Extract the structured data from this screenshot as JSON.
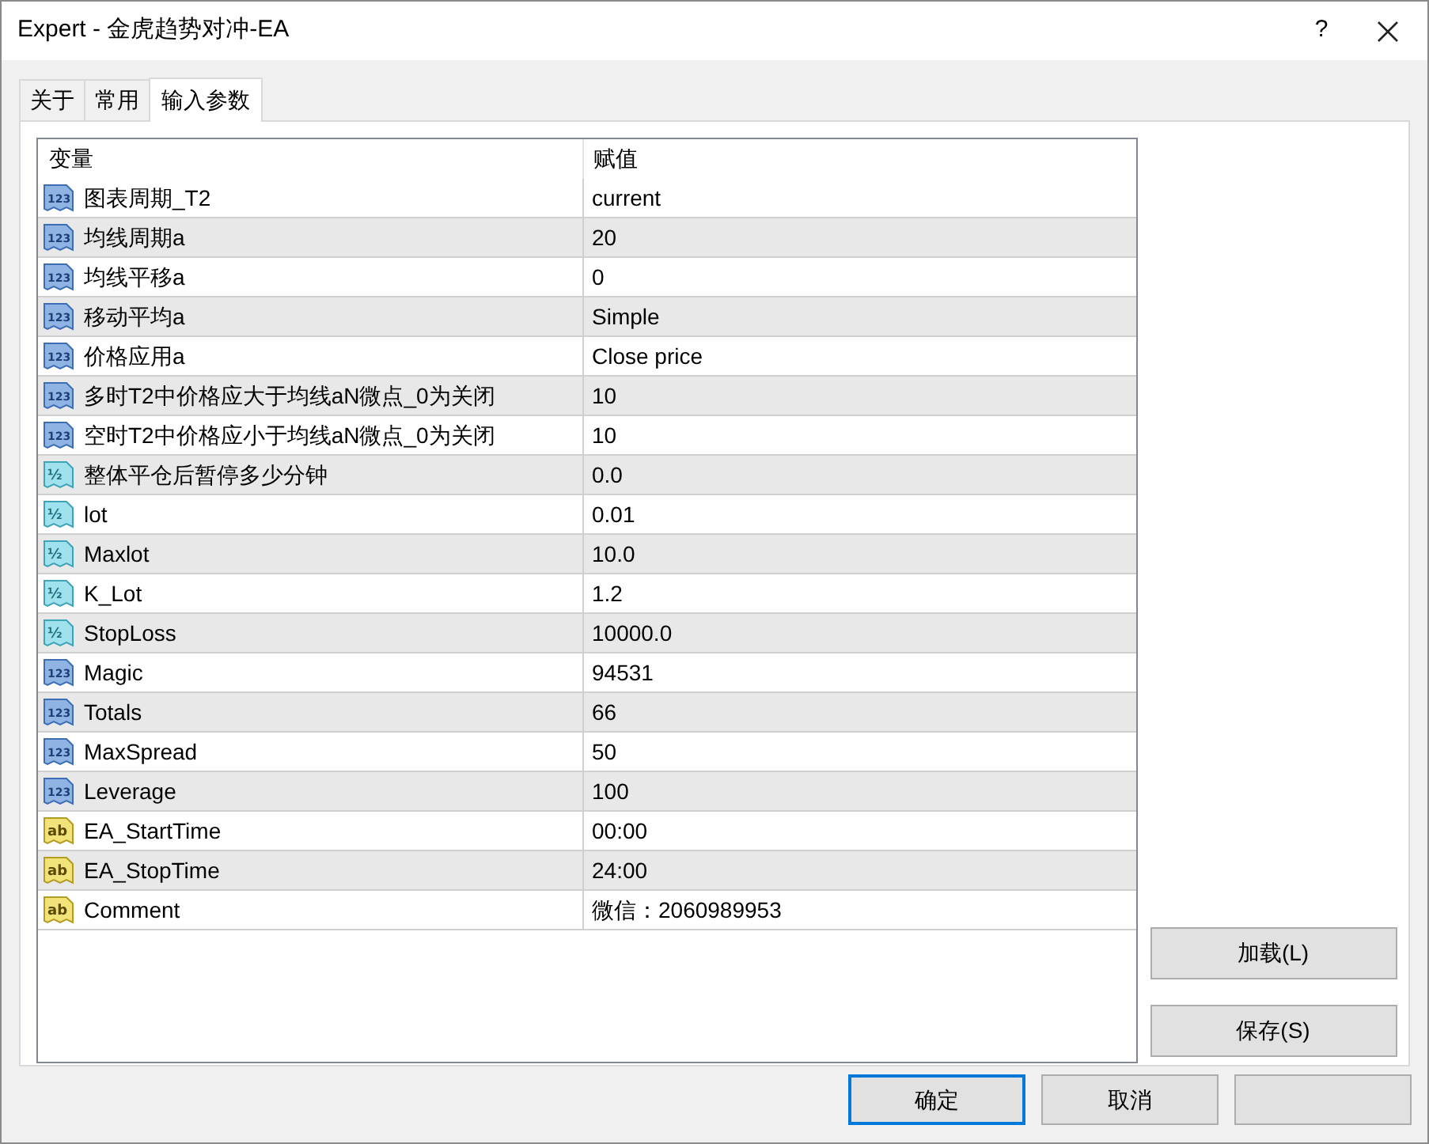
{
  "window": {
    "title": "Expert - 金虎趋势对冲-EA",
    "help": "?"
  },
  "tabs": [
    {
      "label": "关于",
      "selected": false
    },
    {
      "label": "常用",
      "selected": false
    },
    {
      "label": "输入参数",
      "selected": true
    }
  ],
  "table": {
    "columns": [
      "变量",
      "赋值"
    ],
    "rows": [
      {
        "kind": "int",
        "badge": "123",
        "name": "图表周期_T2",
        "value": "current"
      },
      {
        "kind": "int",
        "badge": "123",
        "name": "均线周期a",
        "value": "20"
      },
      {
        "kind": "int",
        "badge": "123",
        "name": "均线平移a",
        "value": "0"
      },
      {
        "kind": "int",
        "badge": "123",
        "name": "移动平均a",
        "value": "Simple"
      },
      {
        "kind": "int",
        "badge": "123",
        "name": "价格应用a",
        "value": "Close price"
      },
      {
        "kind": "int",
        "badge": "123",
        "name": "多时T2中价格应大于均线aN微点_0为关闭",
        "value": "10"
      },
      {
        "kind": "int",
        "badge": "123",
        "name": "空时T2中价格应小于均线aN微点_0为关闭",
        "value": "10"
      },
      {
        "kind": "double",
        "badge": "½",
        "name": "整体平仓后暂停多少分钟",
        "value": "0.0"
      },
      {
        "kind": "double",
        "badge": "½",
        "name": "lot",
        "value": "0.01"
      },
      {
        "kind": "double",
        "badge": "½",
        "name": "Maxlot",
        "value": "10.0"
      },
      {
        "kind": "double",
        "badge": "½",
        "name": "K_Lot",
        "value": "1.2"
      },
      {
        "kind": "double",
        "badge": "½",
        "name": "StopLoss",
        "value": "10000.0"
      },
      {
        "kind": "int",
        "badge": "123",
        "name": "Magic",
        "value": "94531"
      },
      {
        "kind": "int",
        "badge": "123",
        "name": "Totals",
        "value": "66"
      },
      {
        "kind": "int",
        "badge": "123",
        "name": "MaxSpread",
        "value": "50"
      },
      {
        "kind": "int",
        "badge": "123",
        "name": "Leverage",
        "value": "100"
      },
      {
        "kind": "string",
        "badge": "ab",
        "name": "EA_StartTime",
        "value": "00:00"
      },
      {
        "kind": "string",
        "badge": "ab",
        "name": "EA_StopTime",
        "value": "24:00"
      },
      {
        "kind": "string",
        "badge": "ab",
        "name": "Comment",
        "value": "微信：2060989953"
      }
    ]
  },
  "side_buttons": [
    "加载(L)",
    "保存(S)"
  ],
  "buttons": [
    {
      "label": "确定",
      "default": true
    },
    {
      "label": "取消",
      "default": false
    }
  ]
}
